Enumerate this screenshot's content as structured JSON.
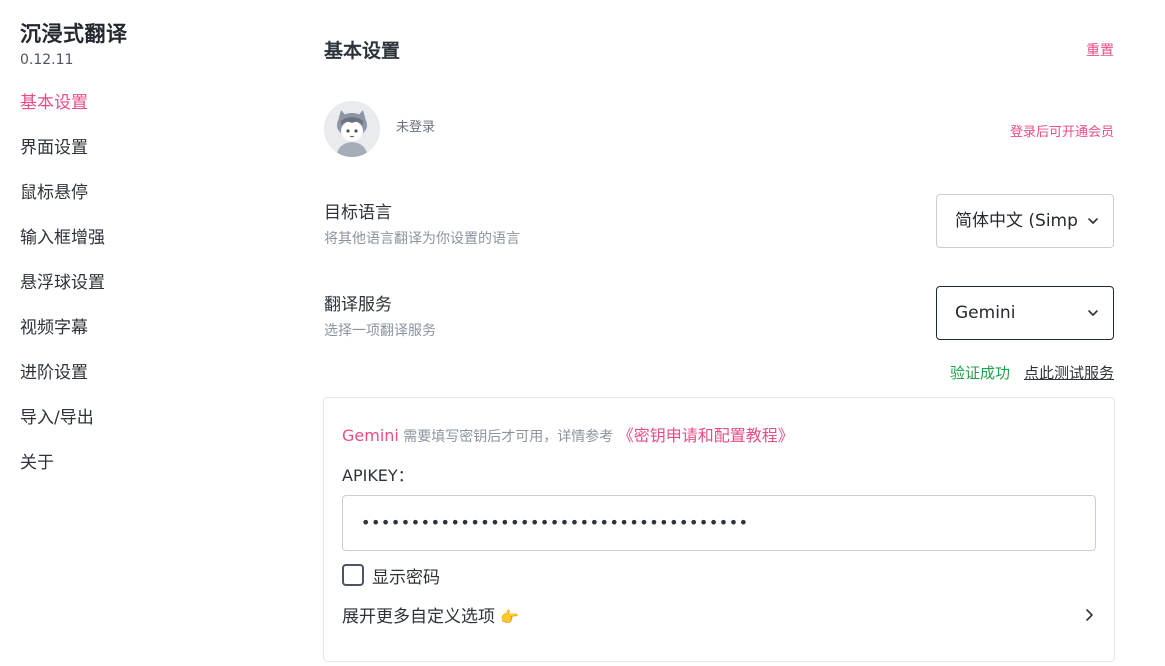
{
  "app": {
    "title": "沉浸式翻译",
    "version": "0.12.11"
  },
  "sidebar": {
    "items": [
      {
        "label": "基本设置",
        "active": true
      },
      {
        "label": "界面设置",
        "active": false
      },
      {
        "label": "鼠标悬停",
        "active": false
      },
      {
        "label": "输入框增强",
        "active": false
      },
      {
        "label": "悬浮球设置",
        "active": false
      },
      {
        "label": "视频字幕",
        "active": false
      },
      {
        "label": "进阶设置",
        "active": false
      },
      {
        "label": "导入/导出",
        "active": false
      },
      {
        "label": "关于",
        "active": false
      }
    ]
  },
  "main": {
    "title": "基本设置",
    "reset_label": "重置",
    "account": {
      "status": "未登录",
      "member_link": "登录后可开通会员",
      "avatar_icon": "cat-avatar-icon"
    },
    "target_language": {
      "label": "目标语言",
      "description": "将其他语言翻译为你设置的语言",
      "value": "简体中文 (Simplified Chinese)"
    },
    "translation_service": {
      "label": "翻译服务",
      "description": "选择一项翻译服务",
      "value": "Gemini",
      "verify_status": "验证成功",
      "test_link": "点此测试服务"
    },
    "service_config": {
      "service_name": "Gemini",
      "note_text": " 需要填写密钥后才可用，详情参考 ",
      "guide_link": "《密钥申请和配置教程》",
      "apikey_label": "APIKEY：",
      "apikey_value": "•••••••••••••••••••••••••••••••••••••••",
      "show_password_label": "显示密码",
      "show_password_checked": false,
      "expand_label": "展开更多自定义选项",
      "expand_emoji": "👉"
    }
  },
  "colors": {
    "accent": "#ea4c89",
    "success": "#22a049",
    "muted": "#8b949e",
    "text": "#2d333a"
  }
}
